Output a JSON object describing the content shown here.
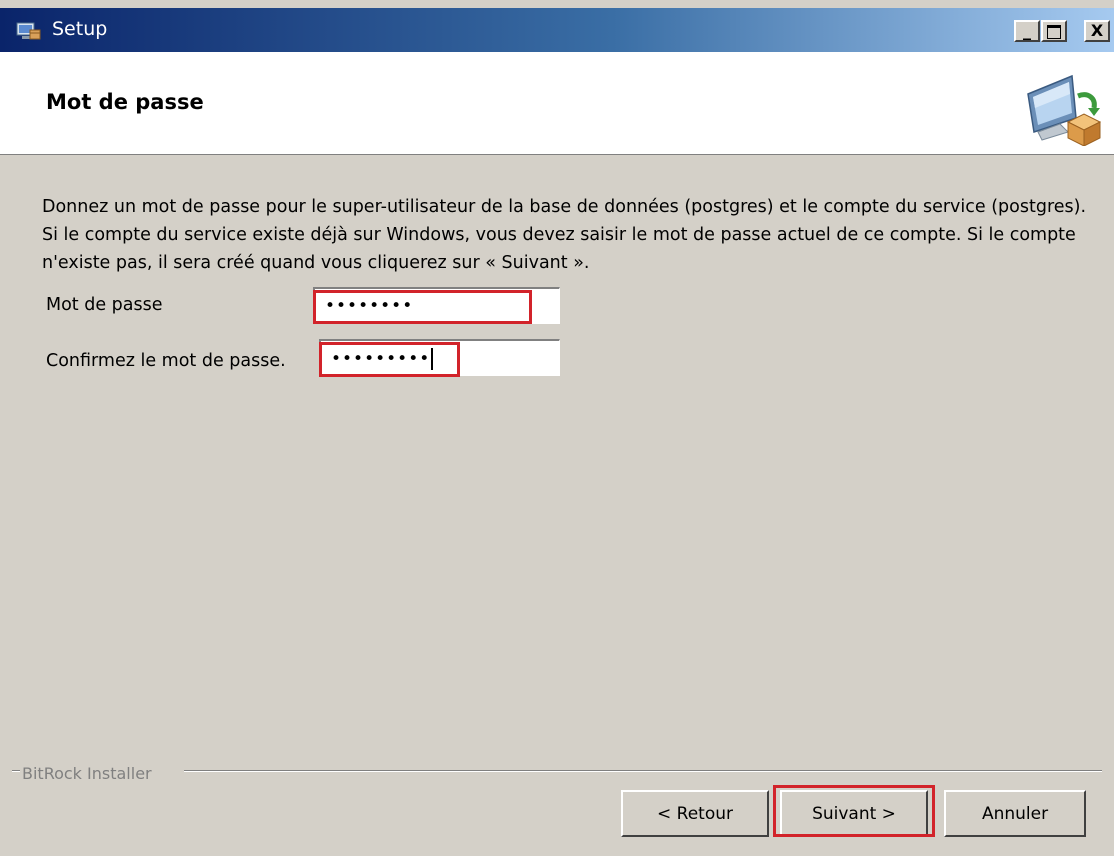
{
  "window": {
    "title": "Setup",
    "controls": {
      "minimize": "_",
      "close": "X"
    }
  },
  "header": {
    "title": "Mot de passe",
    "icon": "computer-install-icon"
  },
  "main": {
    "description": "Donnez un mot de passe pour le super-utilisateur de la base de données (postgres) et le compte du service (postgres). Si le compte du service existe déjà sur Windows, vous devez saisir le mot de passe actuel de ce compte. Si le compte n'existe pas, il sera créé quand vous cliquerez sur « Suivant ».",
    "fields": {
      "password": {
        "label": "Mot de passe",
        "value": "••••••••"
      },
      "confirm": {
        "label": "Confirmez le mot de passe.",
        "value": "•••••••••"
      }
    }
  },
  "footer": {
    "group_label": "BitRock Installer",
    "buttons": {
      "back": "< Retour",
      "next": "Suivant >",
      "cancel": "Annuler"
    }
  },
  "colors": {
    "highlight": "#d2232a",
    "titlebar_start": "#0a246a",
    "titlebar_end": "#a6caf0",
    "dialog_bg": "#d4d0c8"
  }
}
